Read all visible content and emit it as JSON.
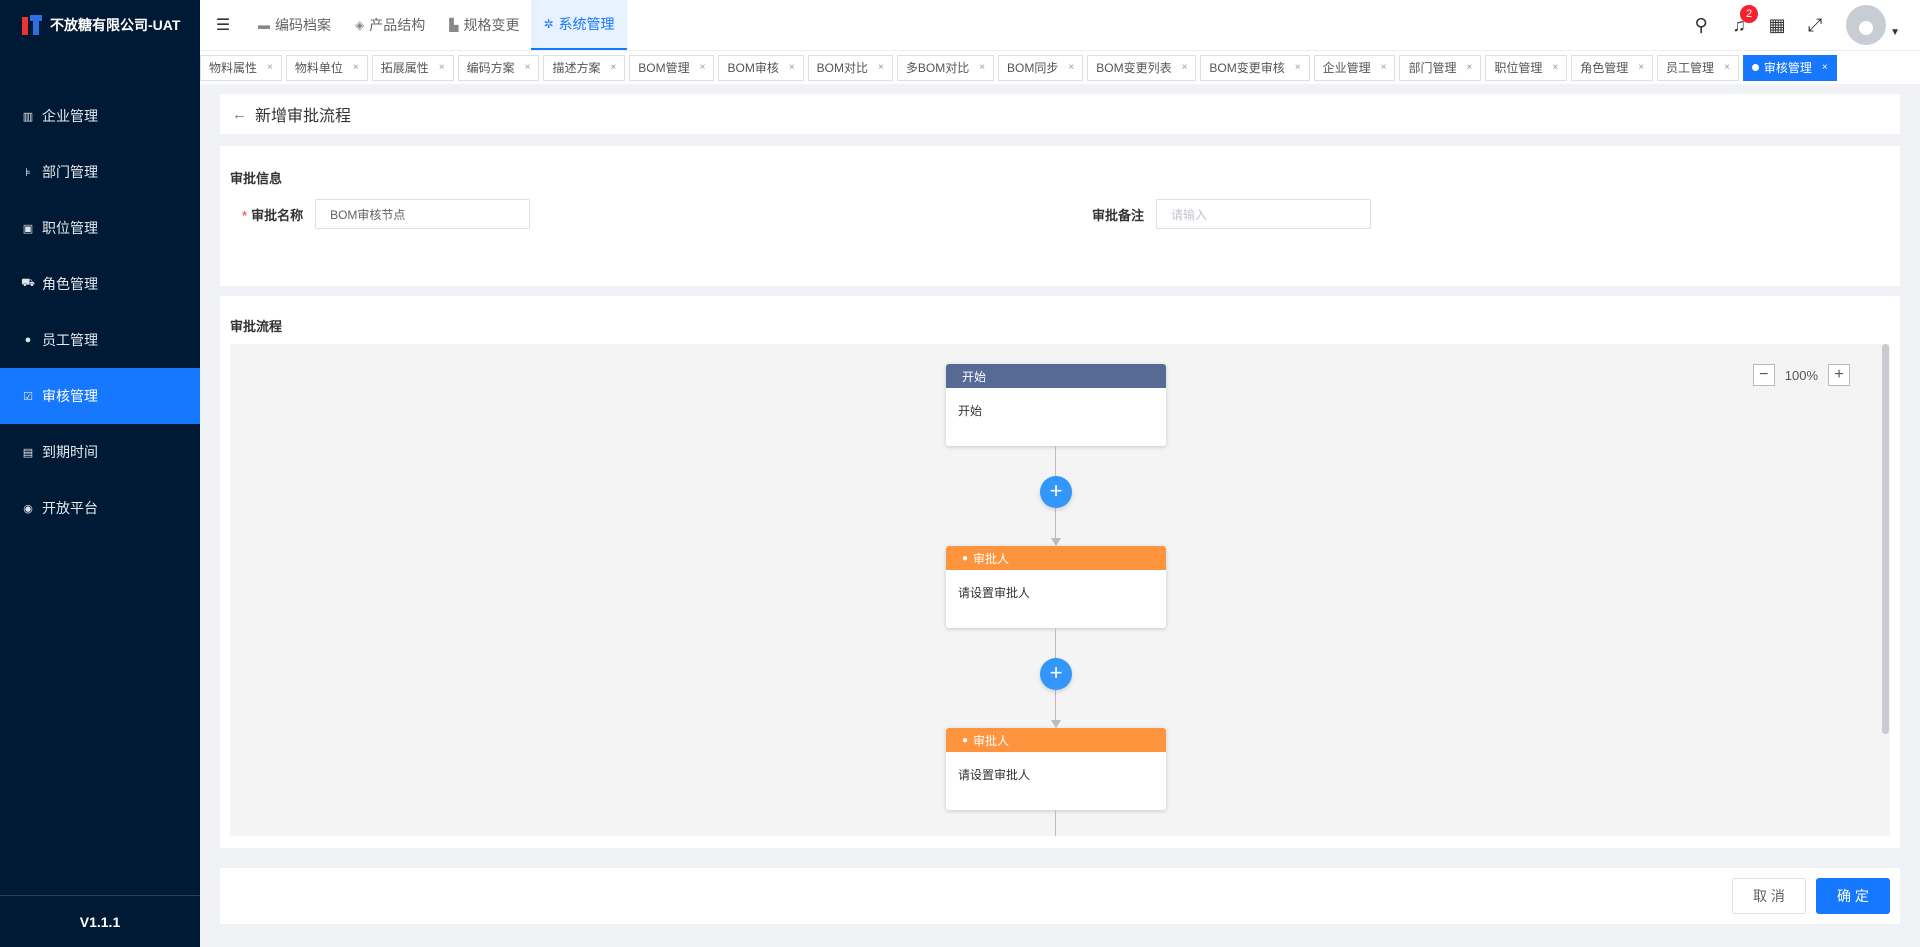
{
  "sidebar": {
    "logo_text": "不放糖有限公司-UAT",
    "items": [
      {
        "label": "企业管理",
        "icon": "building-icon"
      },
      {
        "label": "部门管理",
        "icon": "org-tree-icon"
      },
      {
        "label": "职位管理",
        "icon": "id-card-icon"
      },
      {
        "label": "角色管理",
        "icon": "car-icon"
      },
      {
        "label": "员工管理",
        "icon": "users-icon"
      },
      {
        "label": "审核管理",
        "icon": "check-square-icon",
        "active": true
      },
      {
        "label": "到期时间",
        "icon": "calendar-icon"
      },
      {
        "label": "开放平台",
        "icon": "platform-icon"
      }
    ],
    "version": "V1.1.1"
  },
  "header": {
    "nav": [
      {
        "label": "编码档案",
        "icon": "folder-icon"
      },
      {
        "label": "产品结构",
        "icon": "layers-icon"
      },
      {
        "label": "规格变更",
        "icon": "chart-icon"
      },
      {
        "label": "系统管理",
        "icon": "gear-icon",
        "active": true
      }
    ],
    "notification_count": "2"
  },
  "tabs": [
    "物料属性",
    "物料单位",
    "拓展属性",
    "编码方案",
    "描述方案",
    "BOM管理",
    "BOM审核",
    "BOM对比",
    "多BOM对比",
    "BOM同步",
    "BOM变更列表",
    "BOM变更审核",
    "企业管理",
    "部门管理",
    "职位管理",
    "角色管理",
    "员工管理",
    "审核管理"
  ],
  "active_tab": "审核管理",
  "page": {
    "title": "新增审批流程",
    "info_section": "审批信息",
    "name_label": "审批名称",
    "name_value": "BOM审核节点",
    "remark_label": "审批备注",
    "remark_placeholder": "请输入",
    "flow_section": "审批流程",
    "zoom": "100%"
  },
  "flow": {
    "start_title": "开始",
    "start_body": "开始",
    "approver_title": "审批人",
    "approver_body": "请设置审批人"
  },
  "footer": {
    "cancel": "取 消",
    "confirm": "确 定"
  },
  "colors": {
    "primary": "#1677ff",
    "sidebar_bg": "#001a36",
    "start_node": "#576a95",
    "approver_node": "#ff943e",
    "add_button": "#3296fa"
  }
}
